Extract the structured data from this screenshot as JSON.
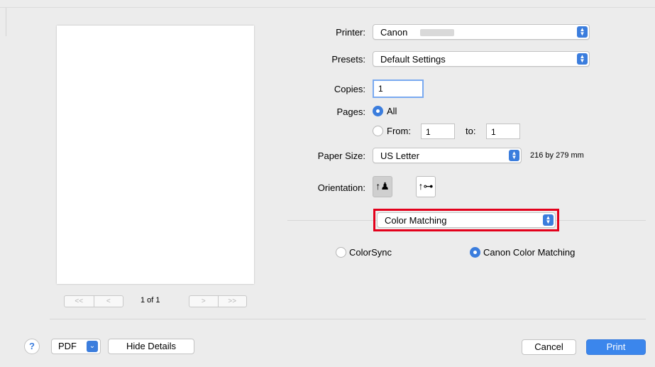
{
  "preview": {
    "nav_first": "<<",
    "nav_prev": "<",
    "page_label": "1 of 1",
    "nav_next": ">",
    "nav_last": ">>"
  },
  "printer": {
    "label": "Printer:",
    "value": "Canon"
  },
  "presets": {
    "label": "Presets:",
    "value": "Default Settings"
  },
  "copies": {
    "label": "Copies:",
    "value": "1"
  },
  "pages": {
    "label": "Pages:",
    "all_label": "All",
    "from_label": "From:",
    "from_value": "1",
    "to_label": "to:",
    "to_value": "1",
    "selected": "All"
  },
  "paper_size": {
    "label": "Paper Size:",
    "value": "US Letter",
    "dimensions": "216 by 279 mm"
  },
  "orientation": {
    "label": "Orientation:",
    "selected": "portrait"
  },
  "section_popup": {
    "value": "Color Matching"
  },
  "color_matching": {
    "option_colorsync": "ColorSync",
    "option_canon": "Canon Color Matching",
    "selected": "Canon Color Matching"
  },
  "footer": {
    "help": "?",
    "pdf": "PDF",
    "hide_details": "Hide Details",
    "cancel": "Cancel",
    "print": "Print"
  },
  "colors": {
    "accent": "#3b7ddd",
    "highlight_box": "#e3001b"
  }
}
